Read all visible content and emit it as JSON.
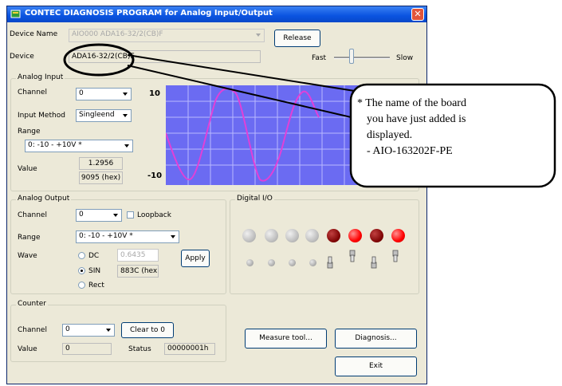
{
  "window": {
    "title": "CONTEC DIAGNOSIS PROGRAM for Analog Input/Output",
    "close_glyph": "✕"
  },
  "device": {
    "name_label": "Device Name",
    "name_value": "AIO000  ADA16-32/2(CB)F",
    "release_label": "Release",
    "device_label": "Device",
    "device_value": "ADA16-32/2(CB)F",
    "fast_label": "Fast",
    "slow_label": "Slow"
  },
  "analog_input": {
    "group_title": "Analog Input",
    "channel_label": "Channel",
    "channel_value": "0",
    "input_method_label": "Input Method",
    "input_method_value": "Singleend",
    "range_label": "Range",
    "range_value": "0: -10 - +10V *",
    "value_label": "Value",
    "value_number": "1.2956",
    "value_hex": "9095 (hex)",
    "graph_max": "10",
    "graph_min": "-10"
  },
  "analog_output": {
    "group_title": "Analog Output",
    "channel_label": "Channel",
    "channel_value": "0",
    "loopback_label": "Loopback",
    "range_label": "Range",
    "range_value": "0: -10 - +10V *",
    "wave_label": "Wave",
    "dc_label": "DC",
    "dc_value": "0.6435",
    "sin_label": "SIN",
    "sin_value": "883C (hex)",
    "rect_label": "Rect",
    "apply_label": "Apply"
  },
  "digital_io": {
    "group_title": "Digital I/O"
  },
  "counter": {
    "group_title": "Counter",
    "channel_label": "Channel",
    "channel_value": "0",
    "clear_label": "Clear to 0",
    "value_label": "Value",
    "value_value": "0",
    "status_label": "Status",
    "status_value": "00000001h"
  },
  "buttons": {
    "measure": "Measure tool...",
    "diagnosis": "Diagnosis...",
    "exit": "Exit"
  },
  "callout": {
    "line1": "* The name of the board",
    "line2": "you have just added is",
    "line3": "displayed.",
    "line4": "- AIO-163202F-PE"
  },
  "colors": {
    "graph_bg": "#6b6bf2",
    "sine": "#e040d8",
    "led_off": "#b8b8b8",
    "led_dark_red": "#7a0000",
    "led_red": "#ff0000"
  }
}
